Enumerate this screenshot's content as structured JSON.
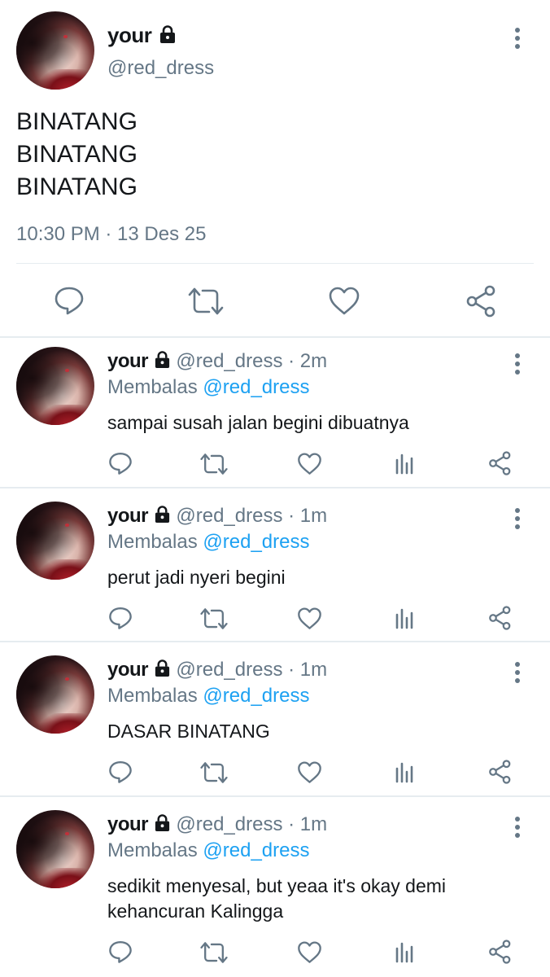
{
  "main_tweet": {
    "name": "your",
    "handle": "@red_dress",
    "lines": [
      "BINATANG",
      "BINATANG",
      "BINATANG"
    ],
    "timestamp": "10:30 PM · 13 Des 25",
    "actions": [
      "reply-icon",
      "retweet-icon",
      "like-icon",
      "share-icon"
    ]
  },
  "replies": [
    {
      "name": "your",
      "handle": "@red_dress",
      "time": "2m",
      "replying_label": "Membalas",
      "replying_to": "@red_dress",
      "text": "sampai susah jalan begini dibuatnya"
    },
    {
      "name": "your",
      "handle": "@red_dress",
      "time": "1m",
      "replying_label": "Membalas",
      "replying_to": "@red_dress",
      "text": "perut jadi nyeri begini"
    },
    {
      "name": "your",
      "handle": "@red_dress",
      "time": "1m",
      "replying_label": "Membalas",
      "replying_to": "@red_dress",
      "text": "DASAR BINATANG"
    },
    {
      "name": "your",
      "handle": "@red_dress",
      "time": "1m",
      "replying_label": "Membalas",
      "replying_to": "@red_dress",
      "text": "sedikit menyesal, but yeaa it's okay demi kehancuran Kalingga"
    }
  ],
  "colors": {
    "text": "#14171a",
    "secondary": "#657786",
    "link": "#1da1f2",
    "divider": "#e6ecf0"
  }
}
